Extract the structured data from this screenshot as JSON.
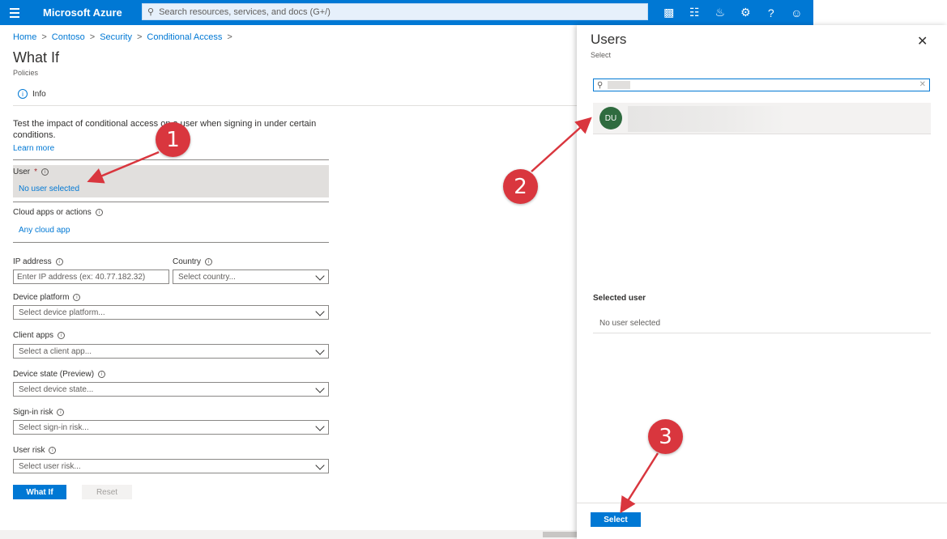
{
  "topbar": {
    "brand": "Microsoft Azure",
    "search_placeholder": "Search resources, services, and docs (G+/)",
    "icons": [
      "cloud-shell-icon",
      "directory-filter-icon",
      "notifications-icon",
      "settings-icon",
      "help-icon",
      "feedback-icon"
    ]
  },
  "breadcrumb": [
    "Home",
    "Contoso",
    "Security",
    "Conditional Access"
  ],
  "page": {
    "title": "What If",
    "subtitle": "Policies",
    "info_tab": "Info",
    "description": "Test the impact of conditional access on a user when signing in under certain conditions.",
    "learn_more": "Learn more"
  },
  "form": {
    "user_label": "User",
    "user_required": "*",
    "user_value": "No user selected",
    "cloud_label": "Cloud apps or actions",
    "cloud_value": "Any cloud app",
    "ip_label": "IP address",
    "ip_placeholder": "Enter IP address (ex: 40.77.182.32)",
    "country_label": "Country",
    "country_value": "Select country...",
    "platform_label": "Device platform",
    "platform_value": "Select device platform...",
    "client_label": "Client apps",
    "client_value": "Select a client app...",
    "state_label": "Device state (Preview)",
    "state_value": "Select device state...",
    "signin_label": "Sign-in risk",
    "signin_value": "Select sign-in risk...",
    "userrisk_label": "User risk",
    "userrisk_value": "Select user risk...",
    "whatif_button": "What If",
    "reset_button": "Reset"
  },
  "panel": {
    "title": "Users",
    "subtitle": "Select",
    "avatar_initials": "DU",
    "selected_heading": "Selected user",
    "selected_value": "No user selected",
    "select_button": "Select"
  },
  "annotations": [
    "1",
    "2",
    "3"
  ],
  "colors": {
    "azure_blue": "#0078d4",
    "marker_red": "#d9363e",
    "avatar_green": "#2f6b3f"
  }
}
